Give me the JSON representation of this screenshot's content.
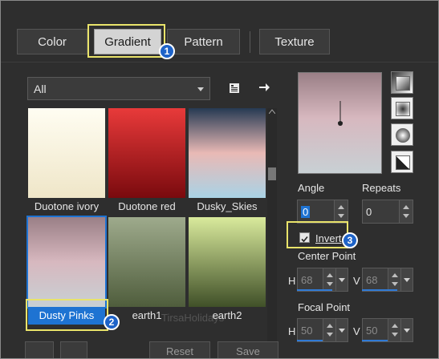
{
  "tabs": [
    {
      "label": "Color",
      "active": false
    },
    {
      "label": "Gradient",
      "active": true
    },
    {
      "label": "Pattern",
      "active": false
    },
    {
      "label": "Texture",
      "active": false
    }
  ],
  "filter": {
    "selected": "All"
  },
  "gradients": [
    {
      "name": "Duotone ivory",
      "colors": [
        "#fffdf2",
        "#efe6c8"
      ]
    },
    {
      "name": "Duotone red",
      "colors": [
        "#e83a3a",
        "#7a0a0e"
      ]
    },
    {
      "name": "Dusky_Skies",
      "colors": [
        "#263a53",
        "#e9b9b5",
        "#a9d3e6"
      ]
    },
    {
      "name": "Dusty Pinks",
      "colors": [
        "#9a7f86",
        "#d7b8bf",
        "#c8d0d4"
      ],
      "selected": true
    },
    {
      "name": "earth1",
      "colors": [
        "#9eaa8c",
        "#4f5d3c"
      ]
    },
    {
      "name": "earth2",
      "colors": [
        "#d9ea9c",
        "#405028"
      ]
    }
  ],
  "angle": {
    "label": "Angle",
    "value": "0"
  },
  "repeats": {
    "label": "Repeats",
    "value": "0"
  },
  "invert": {
    "label": "Invert",
    "checked": true
  },
  "center_point": {
    "label": "Center Point",
    "h_label": "H",
    "h_value": "68",
    "v_label": "V",
    "v_value": "68"
  },
  "focal_point": {
    "label": "Focal Point",
    "h_label": "H",
    "h_value": "50",
    "v_label": "V",
    "v_value": "50"
  },
  "callouts": [
    "1",
    "2",
    "3"
  ],
  "bottom_buttons": {
    "reset": "Reset",
    "save": "Save"
  },
  "watermark": "TirsaHolidays"
}
